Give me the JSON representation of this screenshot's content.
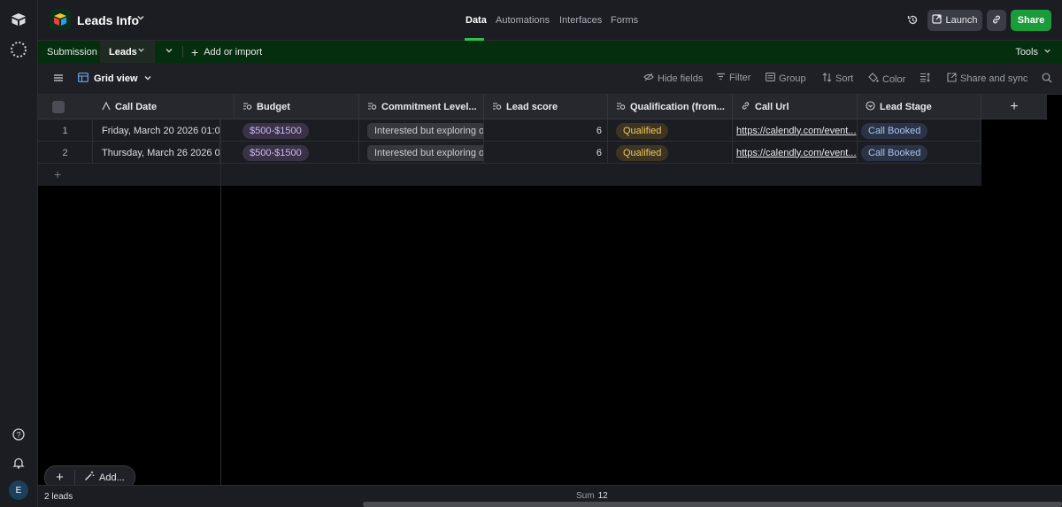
{
  "app": {
    "base_name": "Leads Info",
    "nav_tabs": [
      "Data",
      "Automations",
      "Interfaces",
      "Forms"
    ],
    "active_nav": "Data",
    "launch_label": "Launch",
    "share_label": "Share"
  },
  "tables": {
    "tabs": [
      "Submission",
      "Leads"
    ],
    "active": "Leads",
    "add_import_label": "Add or import",
    "tools_label": "Tools"
  },
  "view": {
    "name": "Grid view",
    "tools": [
      "Hide fields",
      "Filter",
      "Group",
      "Sort",
      "Color",
      "Share and sync"
    ]
  },
  "grid": {
    "columns": [
      {
        "label": "Call Date",
        "icon": "formula-icon"
      },
      {
        "label": "Budget",
        "icon": "lookup-icon"
      },
      {
        "label": "Commitment Level...",
        "icon": "lookup-icon"
      },
      {
        "label": "Lead score",
        "icon": "lookup-icon"
      },
      {
        "label": "Qualification (from...",
        "icon": "lookup-icon"
      },
      {
        "label": "Call Url",
        "icon": "link-icon"
      },
      {
        "label": "Lead Stage",
        "icon": "single-select-icon"
      }
    ],
    "rows": [
      {
        "num": "1",
        "call_date": "Friday, March 20 2026 01:0...",
        "budget": "$500-$1500",
        "commitment": "Interested but exploring opti",
        "lead_score": "6",
        "qualification": "Qualified",
        "call_url": "https://calendly.com/event...",
        "lead_stage": "Call Booked"
      },
      {
        "num": "2",
        "call_date": "Thursday, March 26 2026 0...",
        "budget": "$500-$1500",
        "commitment": "Interested but exploring opti",
        "lead_score": "6",
        "qualification": "Qualified",
        "call_url": "https://calendly.com/event...",
        "lead_stage": "Call Booked"
      }
    ]
  },
  "footer": {
    "record_count": "2 leads",
    "sum_label": "Sum",
    "sum_value": "12",
    "add_label": "Add..."
  },
  "user": {
    "initial": "E"
  },
  "colors": {
    "accent": "#1a9c3a",
    "tabs_bar": "#052e0e"
  }
}
